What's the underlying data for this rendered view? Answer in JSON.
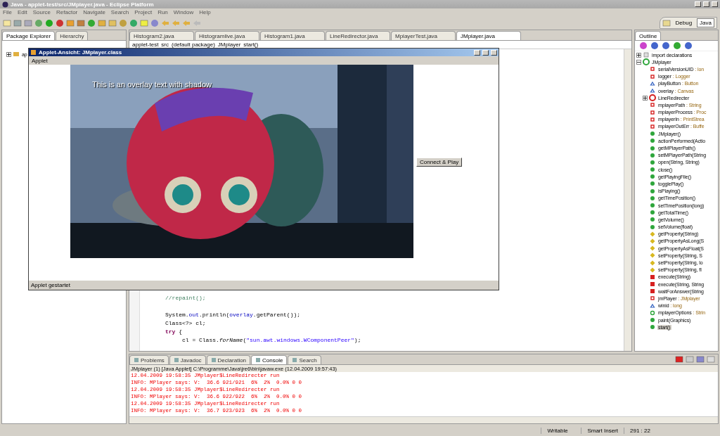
{
  "window": {
    "title": "Java - applet-test/src/JMplayer.java - Eclipse Platform"
  },
  "menu": [
    "File",
    "Edit",
    "Source",
    "Refactor",
    "Navigate",
    "Search",
    "Project",
    "Run",
    "Window",
    "Help"
  ],
  "perspectives": [
    {
      "label": "Debug",
      "selected": false
    },
    {
      "label": "Java",
      "selected": true
    }
  ],
  "left_panel": {
    "tabs": [
      {
        "label": "Package Explorer",
        "selected": true
      },
      {
        "label": "Hierarchy",
        "selected": false
      }
    ],
    "tree": [
      {
        "name": "ap",
        "expanded": false
      }
    ]
  },
  "editor": {
    "tabs": [
      {
        "label": "Histogram2.java",
        "selected": false
      },
      {
        "label": "Histogramlive.java",
        "selected": false
      },
      {
        "label": "Histogram1.java",
        "selected": false
      },
      {
        "label": "LineRedirector.java",
        "selected": false
      },
      {
        "label": "MplayerTest.java",
        "selected": false
      },
      {
        "label": "JMplayer.java",
        "selected": true
      }
    ],
    "breadcrumb": [
      "applet-test",
      "src",
      "(default package)",
      "JMplayer",
      "start()"
    ],
    "code": [
      {
        "segments": [
          {
            "kind": "comment",
            "text": "//repaint();"
          }
        ]
      },
      {
        "blank_before": true,
        "segments": [
          {
            "kind": "plain",
            "text": "System."
          },
          {
            "kind": "field",
            "text": "out"
          },
          {
            "kind": "plain",
            "text": ".println("
          },
          {
            "kind": "field",
            "text": "overlay"
          },
          {
            "kind": "plain",
            "text": ".getParent());"
          }
        ]
      },
      {
        "segments": [
          {
            "kind": "plain",
            "text": "Class<?> cl;"
          }
        ]
      },
      {
        "segments": [
          {
            "kind": "keyword",
            "text": "try"
          },
          {
            "kind": "plain",
            "text": " {"
          }
        ]
      },
      {
        "nested": true,
        "segments": [
          {
            "kind": "plain",
            "text": "cl = Class."
          },
          {
            "kind": "static",
            "text": "forName"
          },
          {
            "kind": "plain",
            "text": "("
          },
          {
            "kind": "string",
            "text": "\"sun.awt.windows.WComponentPeer\""
          },
          {
            "kind": "plain",
            "text": ");"
          }
        ]
      }
    ]
  },
  "outline": {
    "tab": "Outline",
    "items": [
      {
        "kind": "import",
        "name": "import declarations",
        "expanded": false,
        "selected": false
      },
      {
        "kind": "public-class",
        "name": "JMplayer",
        "expanded": true,
        "selected": false,
        "children": [
          {
            "kind": "private-field",
            "name": "serialVersionUID",
            "type": ": lon",
            "selected": false
          },
          {
            "kind": "private-field",
            "name": "logger",
            "type": ": Logger",
            "selected": false
          },
          {
            "kind": "default-field",
            "name": "playButton",
            "type": ": Button",
            "selected": false
          },
          {
            "kind": "default-field",
            "name": "overlay",
            "type": ": Canvas",
            "selected": false
          },
          {
            "kind": "private-class",
            "name": "LineRedirecter",
            "expanded": false,
            "selected": false
          },
          {
            "kind": "private-field",
            "name": "mplayerPath",
            "type": ": String",
            "selected": false
          },
          {
            "kind": "private-field",
            "name": "mplayerProcess",
            "type": ": Proc",
            "selected": false
          },
          {
            "kind": "private-field",
            "name": "mplayerIn",
            "type": ": PrintStrea",
            "selected": false
          },
          {
            "kind": "private-field",
            "name": "mplayerOutErr",
            "type": ": Buffe",
            "selected": false
          },
          {
            "kind": "public-method",
            "name": "JMplayer()",
            "selected": false
          },
          {
            "kind": "public-method",
            "name": "actionPerformed(Actio",
            "selected": false
          },
          {
            "kind": "public-method",
            "name": "getMPlayerPath()",
            "selected": false
          },
          {
            "kind": "public-method",
            "name": "setMPlayerPath(String",
            "selected": false
          },
          {
            "kind": "public-method",
            "name": "open(String, String)",
            "selected": false
          },
          {
            "kind": "public-method",
            "name": "close()",
            "selected": false
          },
          {
            "kind": "public-method",
            "name": "getPlayingFile()",
            "selected": false
          },
          {
            "kind": "public-method",
            "name": "togglePlay()",
            "selected": false
          },
          {
            "kind": "public-method",
            "name": "isPlaying()",
            "selected": false
          },
          {
            "kind": "public-method",
            "name": "getTimePosition()",
            "selected": false
          },
          {
            "kind": "public-method",
            "name": "setTimePosition(long)",
            "selected": false
          },
          {
            "kind": "public-method",
            "name": "getTotalTime()",
            "selected": false
          },
          {
            "kind": "public-method",
            "name": "getVolume()",
            "selected": false
          },
          {
            "kind": "public-method",
            "name": "setVolume(float)",
            "selected": false
          },
          {
            "kind": "protected-method",
            "name": "getProperty(String)",
            "selected": false
          },
          {
            "kind": "protected-method",
            "name": "getPropertyAsLong(S",
            "selected": false
          },
          {
            "kind": "protected-method",
            "name": "getPropertyAsFloat(S",
            "selected": false
          },
          {
            "kind": "protected-method",
            "name": "setProperty(String, S",
            "selected": false
          },
          {
            "kind": "protected-method",
            "name": "setProperty(String, lo",
            "selected": false
          },
          {
            "kind": "protected-method",
            "name": "setProperty(String, fl",
            "selected": false
          },
          {
            "kind": "private-method",
            "name": "execute(String)",
            "selected": false
          },
          {
            "kind": "private-method",
            "name": "execute(String, String",
            "selected": false
          },
          {
            "kind": "private-method",
            "name": "waitForAnswer(String",
            "selected": false
          },
          {
            "kind": "private-field",
            "name": "jmPlayer",
            "type": ": JMplayer",
            "selected": false
          },
          {
            "kind": "default-field",
            "name": "winid",
            "type": ": long",
            "selected": false
          },
          {
            "kind": "public-field",
            "name": "mplayerOptions",
            "type": ": Strin",
            "selected": false
          },
          {
            "kind": "public-method",
            "name": "paint(Graphics)",
            "selected": false
          },
          {
            "kind": "public-method",
            "name": "start()",
            "selected": true
          }
        ]
      }
    ]
  },
  "applet": {
    "title": "Applet-Ansicht: JMplayer.class",
    "menu": "Applet",
    "overlay_text": "This is an overlay text with shadow",
    "button": "Connect & Play",
    "status": "Applet gestartet"
  },
  "console": {
    "tabs": [
      {
        "label": "Problems",
        "selected": false
      },
      {
        "label": "Javadoc",
        "selected": false
      },
      {
        "label": "Declaration",
        "selected": false
      },
      {
        "label": "Console",
        "selected": true
      },
      {
        "label": "Search",
        "selected": false
      }
    ],
    "header": "JMplayer (1) [Java Applet] C:\\Programme\\Java\\jre6\\bin\\javaw.exe (12.04.2009 19:57:43)",
    "lines": [
      "12.04.2009 19:58:35 JMplayer$LineRedirecter run",
      "INFO: MPlayer says: V:  36.6 921/921  6%  2%  0.0% 0 0",
      "12.04.2009 19:58:35 JMplayer$LineRedirecter run",
      "INFO: MPlayer says: V:  36.6 922/922  6%  2%  0.0% 0 0",
      "12.04.2009 19:58:35 JMplayer$LineRedirecter run",
      "INFO: MPlayer says: V:  36.7 923/923  6%  2%  0.0% 0 0"
    ]
  },
  "status_bar": [
    "Writable",
    "Smart Insert",
    "291 : 22"
  ]
}
